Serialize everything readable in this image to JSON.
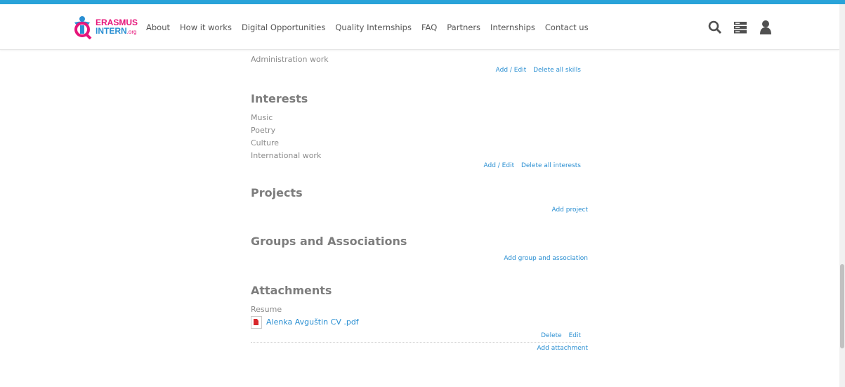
{
  "brand": {
    "line1": "ERASMUS",
    "line2": "INTERN",
    "suffix": ".org",
    "colors": {
      "pink": "#e6157a",
      "blue": "#2a8fd2",
      "accent": "#29a3d9"
    }
  },
  "nav": [
    "About",
    "How it works",
    "Digital Opportunities",
    "Quality Internships",
    "FAQ",
    "Partners",
    "Internships",
    "Contact us"
  ],
  "header_icons": [
    "search-icon",
    "menu-icon",
    "user-icon"
  ],
  "skills": {
    "last_item": "Administration work",
    "actions": [
      "Add / Edit",
      "Delete all skills"
    ]
  },
  "interests": {
    "title": "Interests",
    "items": [
      "Music",
      "Poetry",
      "Culture",
      "International work"
    ],
    "actions": [
      "Add / Edit",
      "Delete all interests"
    ]
  },
  "projects": {
    "title": "Projects",
    "action": "Add project"
  },
  "groups": {
    "title": "Groups and Associations",
    "action": "Add group and association"
  },
  "attachments": {
    "title": "Attachments",
    "label": "Resume",
    "file": "Alenka Avguštin CV .pdf",
    "file_actions": [
      "Delete",
      "Edit"
    ],
    "add": "Add attachment"
  }
}
